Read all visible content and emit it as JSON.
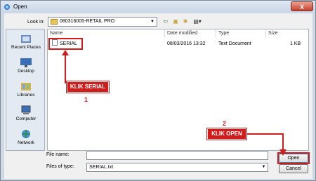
{
  "window": {
    "title": "Open",
    "close_label": "X"
  },
  "lookin": {
    "label": "Look in:",
    "value": "080316005-RETAIL PRO"
  },
  "places": [
    {
      "label": "Recent Places",
      "icon": "recent-places-icon"
    },
    {
      "label": "Desktop",
      "icon": "desktop-icon"
    },
    {
      "label": "Libraries",
      "icon": "libraries-icon"
    },
    {
      "label": "Computer",
      "icon": "computer-icon"
    },
    {
      "label": "Network",
      "icon": "network-icon"
    }
  ],
  "columns": {
    "name": "Name",
    "date": "Date modified",
    "type": "Type",
    "size": "Size"
  },
  "files": [
    {
      "name": "SERIAL",
      "date": "08/03/2016 13:32",
      "type": "Text Document",
      "size": "1 KB"
    }
  ],
  "form": {
    "filename_label": "File name:",
    "filename_value": "",
    "filetype_label": "Files of type:",
    "filetype_value": "SERIAL.txt"
  },
  "buttons": {
    "open": "Open",
    "cancel": "Cancel"
  },
  "annotations": {
    "step1_label": "KLIK SERIAL",
    "step1_number": "1",
    "step2_label": "KLIK OPEN",
    "step2_number": "2",
    "color": "#d21b1b"
  }
}
